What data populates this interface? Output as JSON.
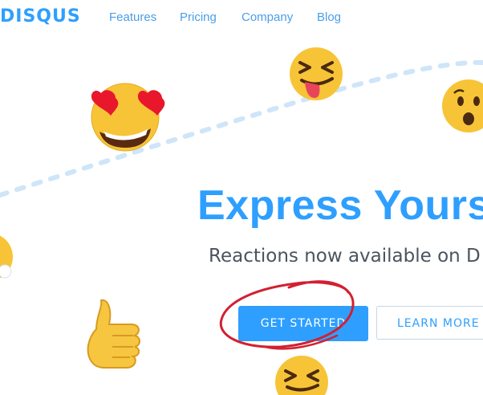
{
  "header": {
    "logo_text": "DISQUS",
    "nav": [
      {
        "label": "Features"
      },
      {
        "label": "Pricing"
      },
      {
        "label": "Company"
      },
      {
        "label": "Blog"
      }
    ]
  },
  "hero": {
    "title": "Express Yours",
    "subtitle": "Reactions now available on D",
    "primary_button": "GET STARTED",
    "secondary_button": "LEARN MORE"
  },
  "colors": {
    "brand": "#2e9fff",
    "nav_text": "#4a9ee8",
    "subtitle_text": "#4a545f",
    "annotation": "#d22030"
  },
  "icons": [
    "heart-eyes-emoji",
    "squinting-tongue-emoji",
    "surprised-emoji",
    "thumbs-up-emoji",
    "partial-emoji",
    "squinting-tongue-emoji-bottom"
  ]
}
